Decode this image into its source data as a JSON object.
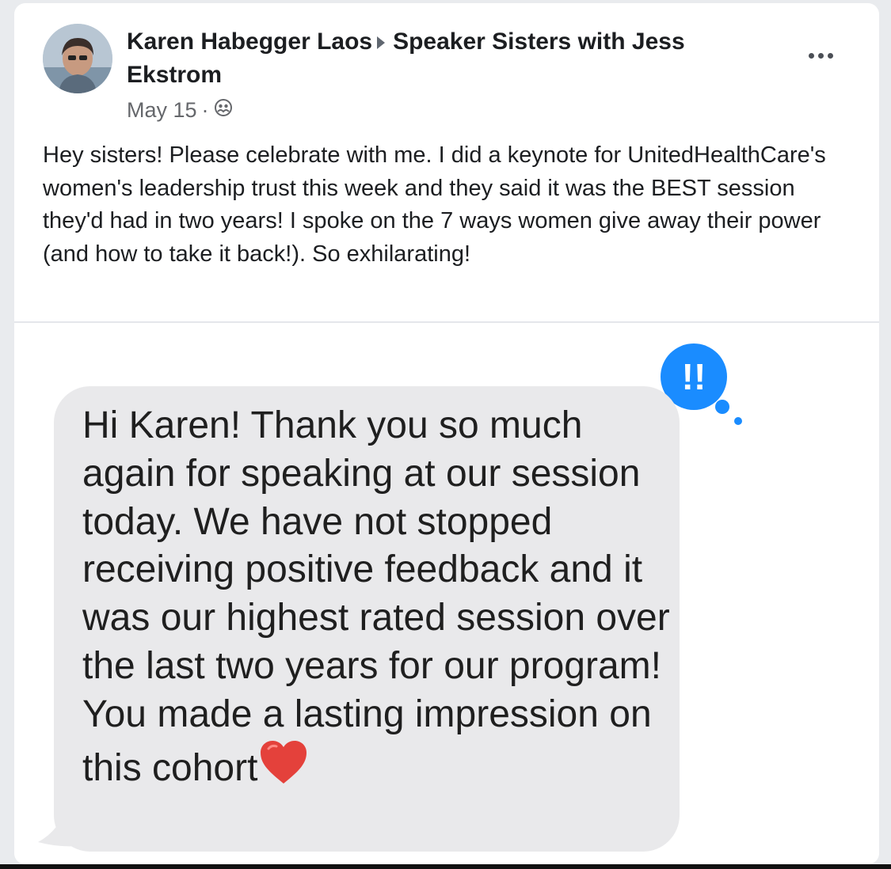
{
  "post": {
    "author": "Karen Habegger Laos",
    "group": "Speaker Sisters with Jess Ekstrom",
    "date": "May 15",
    "separator": "·",
    "privacy_icon": "group-icon",
    "body": "Hey sisters! Please celebrate with me. I did a keynote for UnitedHealthCare's women's leadership trust this week and they said it was the BEST session they'd had in two years! I spoke on the 7 ways women give away their power (and how to take it back!). So exhilarating!",
    "more_icon": "more-options-icon"
  },
  "message": {
    "text": "Hi Karen! Thank you so much again for speaking at our session today. We have not stopped receiving positive feedback and it was our highest rated session over the last two years for our program! You made a lasting impression on this cohort",
    "emoji": "heart",
    "tapback": "!!",
    "tapback_color": "#1a8cff",
    "bubble_color": "#e9e9eb"
  }
}
